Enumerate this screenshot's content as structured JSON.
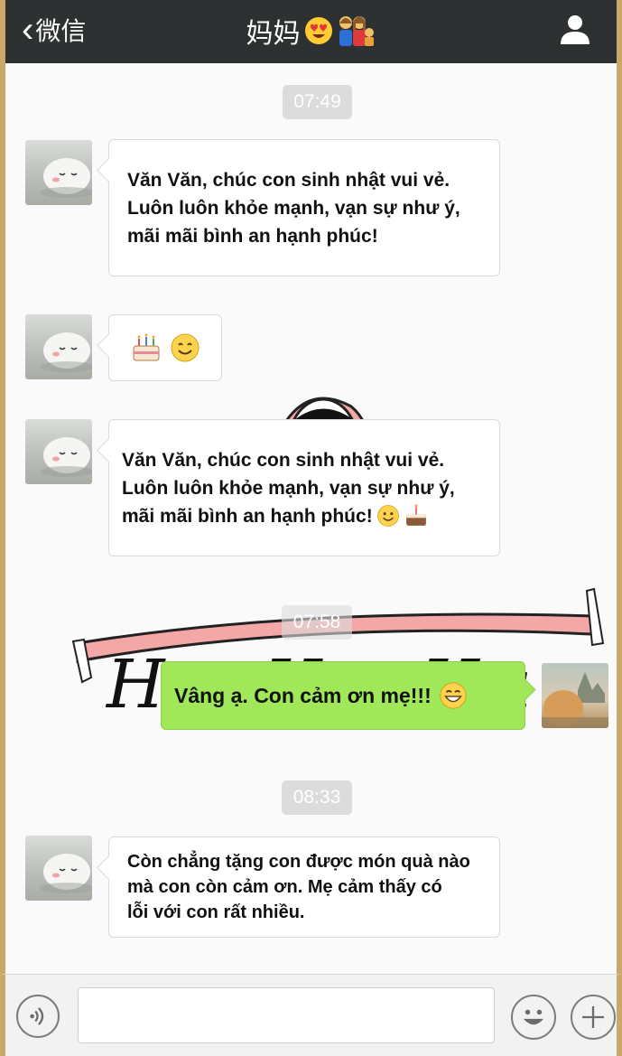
{
  "navbar": {
    "back_label": "微信",
    "title": "妈妈"
  },
  "messages": [
    {
      "type": "time",
      "text": "07:49"
    },
    {
      "type": "incoming",
      "lines": [
        "Văn Văn, chúc con sinh nhật vui vẻ.",
        "Luôn luôn khỏe mạnh, vạn sự như ý,",
        "mãi mãi bình an hạnh phúc!"
      ]
    },
    {
      "type": "incoming",
      "emojis": [
        "cake-emoji",
        "smile-emoji"
      ]
    },
    {
      "type": "incoming",
      "lines": [
        "Văn Văn, chúc con sinh nhật vui vẻ.",
        "Luôn luôn khỏe mạnh, vạn sự như ý,",
        "mãi mãi bình an hạnh phúc!"
      ]
    },
    {
      "type": "time",
      "text": "07:58"
    },
    {
      "type": "outgoing",
      "text": "Vâng ạ. Con cảm ơn mẹ!!!"
    },
    {
      "type": "time",
      "text": "08:33"
    },
    {
      "type": "incoming",
      "lines": [
        "Còn chẳng tặng con được món quà nào",
        "mà con còn cảm ơn. Mẹ cảm thấy có",
        "lỗi với con rất nhiều."
      ]
    }
  ],
  "sticker": {
    "text": "Ha Ha Ha"
  },
  "inputbar": {
    "placeholder": ""
  },
  "colors": {
    "navbar": "#2e3132",
    "outgoing_bubble": "#a0e75a",
    "frame_border": "#c9a86a"
  }
}
